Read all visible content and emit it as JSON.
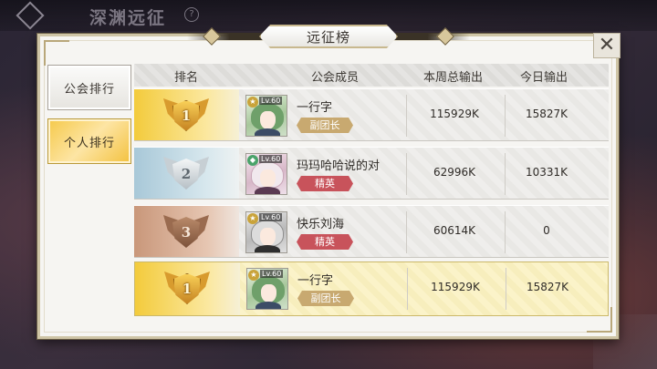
{
  "background": {
    "screen_title": "深渊远征",
    "help_glyph": "?"
  },
  "dialog": {
    "title": "远征榜",
    "close_glyph": "✕"
  },
  "tabs": [
    {
      "label": "公会排行",
      "active": false
    },
    {
      "label": "个人排行",
      "active": true
    }
  ],
  "table": {
    "headers": {
      "rank": "排名",
      "member": "公会成员",
      "weekly_output": "本周总输出",
      "today_output": "今日输出"
    },
    "rows": [
      {
        "rank": "1",
        "level": "Lv.60",
        "name": "一行字",
        "role": "副团长",
        "weekly_output": "115929K",
        "today_output": "15827K"
      },
      {
        "rank": "2",
        "level": "Lv.60",
        "name": "玛玛哈哈说的对",
        "role": "精英",
        "weekly_output": "62996K",
        "today_output": "10331K"
      },
      {
        "rank": "3",
        "level": "Lv.60",
        "name": "快乐刘海",
        "role": "精英",
        "weekly_output": "60614K",
        "today_output": "0"
      }
    ],
    "self_row": {
      "rank": "1",
      "level": "Lv.60",
      "name": "一行字",
      "role": "副团长",
      "weekly_output": "115929K",
      "today_output": "15827K"
    }
  },
  "colors": {
    "gold": "#f3cb3c",
    "silver": "#a8c8d8",
    "bronze": "#c9977a",
    "role_vice": "#c8a970",
    "role_elite": "#c8535b",
    "self_highlight": "#fbf3c9"
  }
}
